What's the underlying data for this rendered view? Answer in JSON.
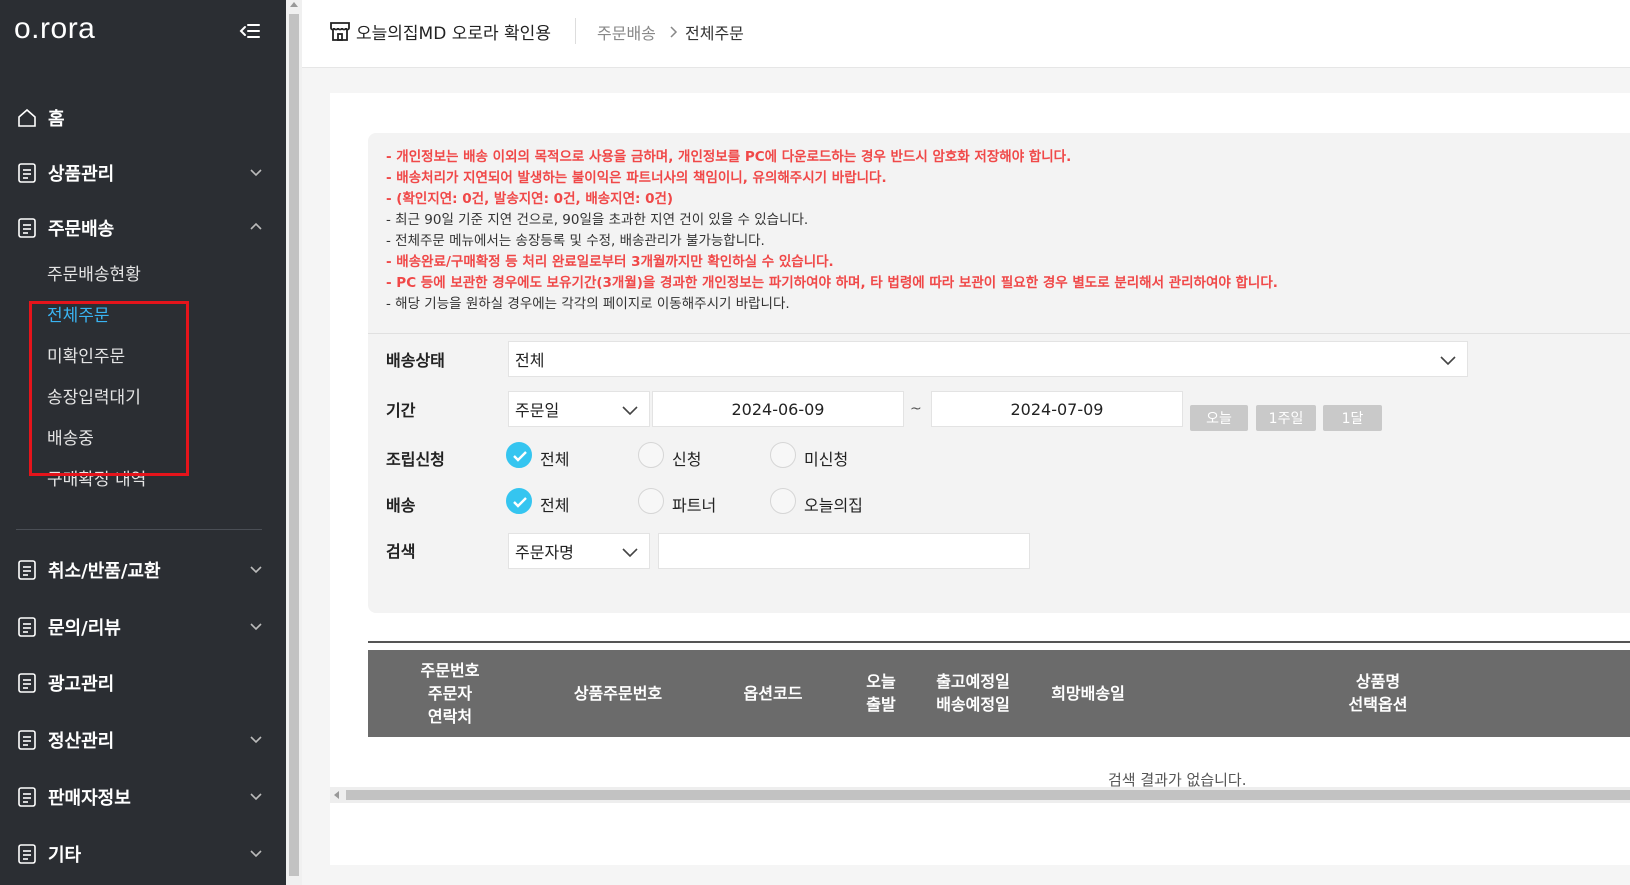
{
  "sidebar": {
    "logo": "o.rora",
    "menu": [
      {
        "label": "홈"
      },
      {
        "label": "상품관리"
      },
      {
        "label": "주문배송"
      },
      {
        "label": "취소/반품/교환"
      },
      {
        "label": "문의/리뷰"
      },
      {
        "label": "광고관리"
      },
      {
        "label": "정산관리"
      },
      {
        "label": "판매자정보"
      },
      {
        "label": "기타"
      }
    ],
    "submenu": [
      {
        "label": "주문배송현황"
      },
      {
        "label": "전체주문"
      },
      {
        "label": "미확인주문"
      },
      {
        "label": "송장입력대기"
      },
      {
        "label": "배송중"
      },
      {
        "label": "구매확정 내역"
      }
    ],
    "active_submenu": "전체주문"
  },
  "header": {
    "store_name": "오늘의집MD 오로라 확인용",
    "breadcrumb_parent": "주문배송",
    "breadcrumb_current": "전체주문"
  },
  "notice": [
    {
      "text": "- 개인정보는 배송 이외의 목적으로 사용을 금하며, 개인정보를 PC에 다운로드하는 경우 반드시 암호화 저장해야 합니다.",
      "color": "red"
    },
    {
      "text": "- 배송처리가 지연되어 발생하는 불이익은 파트너사의 책임이니, 유의해주시기 바랍니다.",
      "color": "red"
    },
    {
      "text": "- (확인지연: 0건, 발송지연: 0건, 배송지연: 0건)",
      "color": "red"
    },
    {
      "text": "- 최근 90일 기준 지연 건으로, 90일을 초과한 지연 건이 있을 수 있습니다.",
      "color": "black"
    },
    {
      "text": "- 전체주문 메뉴에서는 송장등록 및 수정, 배송관리가 불가능합니다.",
      "color": "black"
    },
    {
      "text": "- 배송완료/구매확정 등 처리 완료일로부터 3개월까지만 확인하실 수 있습니다.",
      "color": "red"
    },
    {
      "text": "- PC 등에 보관한 경우에도 보유기간(3개월)을 경과한 개인정보는 파기하여야 하며, 타 법령에 따라 보관이 필요한 경우 별도로 분리해서 관리하여야 합니다.",
      "color": "red"
    },
    {
      "text": "- 해당 기능을 원하실 경우에는 각각의 페이지로 이동해주시기 바랍니다.",
      "color": "black"
    }
  ],
  "filters": {
    "delivery_status": {
      "label": "배송상태",
      "value": "전체"
    },
    "period": {
      "label": "기간",
      "type_value": "주문일",
      "start_date": "2024-06-09",
      "tilde": "~",
      "end_date": "2024-07-09",
      "quick_buttons": [
        "오늘",
        "1주일",
        "1달"
      ]
    },
    "assembly": {
      "label": "조립신청",
      "options": [
        "전체",
        "신청",
        "미신청"
      ],
      "selected": "전체"
    },
    "shipping": {
      "label": "배송",
      "options": [
        "전체",
        "파트너",
        "오늘의집"
      ],
      "selected": "전체"
    },
    "search": {
      "label": "검색",
      "type_value": "주문자명",
      "value": ""
    }
  },
  "table": {
    "headers": [
      "주문번호\n주문자\n연락처",
      "상품주문번호",
      "옵션코드",
      "오늘\n출발",
      "출고예정일\n배송예정일",
      "희망배송일",
      "상품명\n선택옵션"
    ],
    "empty_message": "검색 결과가 없습니다."
  },
  "colors": {
    "sidebar_bg": "#2b2e33",
    "active_submenu": "#3ab4f2",
    "accent": "#35c5f0",
    "notice_red": "#f04848",
    "highlight": "#e5141b",
    "table_header_bg": "#6b6b6b"
  }
}
